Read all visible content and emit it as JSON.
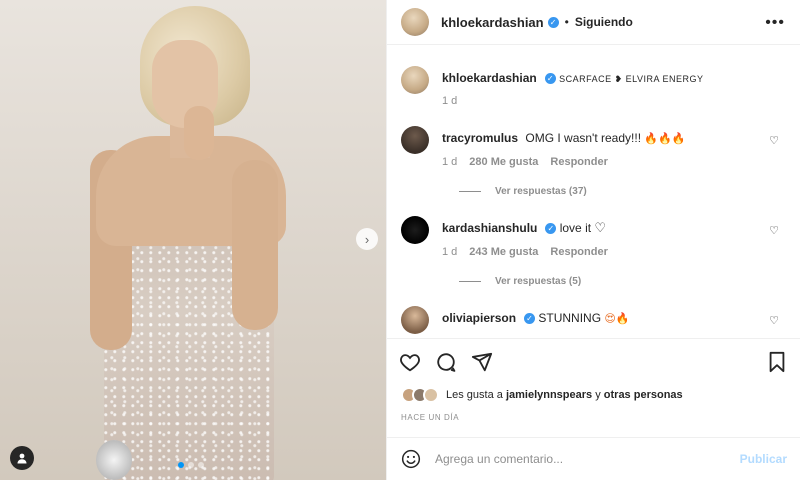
{
  "post": {
    "author": "khloekardashian",
    "follow_status": "Siguiendo",
    "bullet": "•",
    "more": "•••",
    "next": "›"
  },
  "caption": {
    "user": "khloekardashian",
    "text": "Scarface ❥ Elvira Energy",
    "time": "1 d"
  },
  "comments": [
    {
      "user": "tracyromulus",
      "text": "OMG I wasn't ready!!! ",
      "emoji": "🔥🔥🔥",
      "time": "1 d",
      "likes": "280 Me gusta",
      "reply": "Responder",
      "replies": "Ver respuestas (37)"
    },
    {
      "user": "kardashianshulu",
      "text": "love it ",
      "emoji": "♡",
      "time": "1 d",
      "likes": "243 Me gusta",
      "reply": "Responder",
      "replies": "Ver respuestas (5)"
    },
    {
      "user": "oliviapierson",
      "text": "STUNNING ",
      "emoji": "😍🔥"
    }
  ],
  "likes": {
    "prefix": "Les gusta a ",
    "user": "jamielynnspears",
    "middle": " y ",
    "others": "otras personas"
  },
  "time_ago": "HACE UN DÍA",
  "add_comment": {
    "placeholder": "Agrega un comentario...",
    "publish": "Publicar"
  },
  "colors": {
    "verified": "#3897f0",
    "accent": "#0095f6",
    "publish_disabled": "#b3dbff"
  },
  "icons": [
    "heart-icon",
    "comment-icon",
    "share-icon",
    "bookmark-icon",
    "smile-icon",
    "tag-user-icon",
    "chevron-right-icon",
    "more-icon"
  ]
}
